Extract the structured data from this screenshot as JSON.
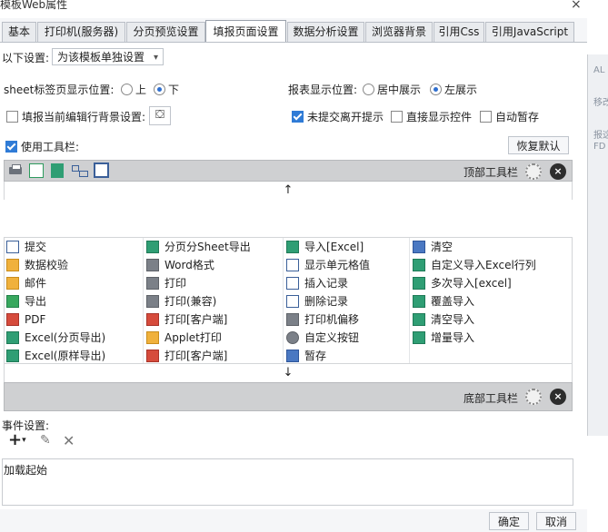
{
  "window": {
    "title": "模板Web属性",
    "close_glyph": "×"
  },
  "right_strip": {
    "line1": "AL",
    "line2": "移改_",
    "line3": "报这",
    "line4": "FD"
  },
  "tabs": [
    {
      "label": "基本"
    },
    {
      "label": "打印机(服务器)"
    },
    {
      "label": "分页预览设置"
    },
    {
      "label": "填报页面设置"
    },
    {
      "label": "数据分析设置"
    },
    {
      "label": "浏览器背景"
    },
    {
      "label": "引用Css"
    },
    {
      "label": "引用JavaScript"
    }
  ],
  "settings": {
    "scope_label": "以下设置:",
    "scope_value": "为该模板单独设置",
    "sheet_tab_label": "sheet标签页显示位置:",
    "sheet_top": "上",
    "sheet_bottom": "下",
    "report_pos_label": "报表显示位置:",
    "report_center": "居中展示",
    "report_left": "左展示",
    "fill_bg_label": "填报当前编辑行背景设置:",
    "unsubmitted_label": "未提交离开提示",
    "direct_show_label": "直接显示控件",
    "autosave_label": "自动暂存",
    "use_toolbar_label": "使用工具栏:",
    "restore_default": "恢复默认"
  },
  "top_toolbar": {
    "label": "顶部工具栏",
    "up_arrow": "↑"
  },
  "bottom_toolbar": {
    "label": "底部工具栏",
    "down_arrow": "↓"
  },
  "buttons_grid": [
    [
      "提交",
      "分页分Sheet导出",
      "导入[Excel]",
      "清空"
    ],
    [
      "数据校验",
      "Word格式",
      "显示单元格值",
      "自定义导入Excel行列"
    ],
    [
      "邮件",
      "打印",
      "插入记录",
      "多次导入[excel]"
    ],
    [
      "导出",
      "打印(兼容)",
      "删除记录",
      "覆盖导入"
    ],
    [
      "PDF",
      "打印[客户端]",
      "打印机偏移",
      "清空导入"
    ],
    [
      "Excel(分页导出)",
      "Applet打印",
      "自定义按钮",
      "增量导入"
    ],
    [
      "Excel(原样导出)",
      "打印[客户端]",
      "暂存",
      ""
    ]
  ],
  "events": {
    "label": "事件设置:",
    "add_glyph": "+",
    "item": "加载起始"
  },
  "footer": {
    "ok": "确定",
    "cancel": "取消"
  }
}
